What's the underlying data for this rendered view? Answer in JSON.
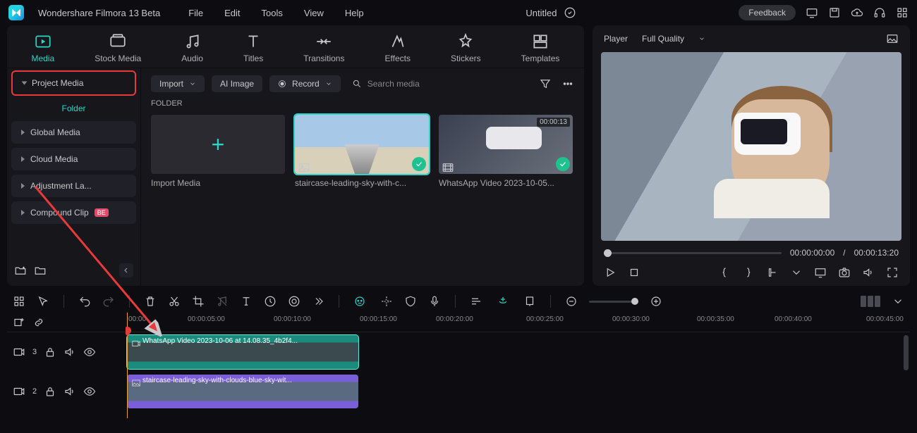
{
  "app": {
    "title": "Wondershare Filmora 13 Beta"
  },
  "menu": [
    "File",
    "Edit",
    "Tools",
    "View",
    "Help"
  ],
  "document": {
    "name": "Untitled"
  },
  "title_actions": {
    "feedback": "Feedback"
  },
  "main_tabs": [
    "Media",
    "Stock Media",
    "Audio",
    "Titles",
    "Transitions",
    "Effects",
    "Stickers",
    "Templates"
  ],
  "sidebar": {
    "project_media": "Project Media",
    "folder_label": "Folder",
    "items": [
      {
        "label": "Global Media"
      },
      {
        "label": "Cloud Media"
      },
      {
        "label": "Adjustment La..."
      },
      {
        "label": "Compound Clip",
        "badge": "BE"
      }
    ]
  },
  "media_toolbar": {
    "import": "Import",
    "ai_image": "AI Image",
    "record": "Record",
    "search_placeholder": "Search media"
  },
  "media_area": {
    "folder_heading": "FOLDER",
    "import_media": "Import Media",
    "thumbs": [
      {
        "label": "staircase-leading-sky-with-c...",
        "selected": true
      },
      {
        "label": "WhatsApp Video 2023-10-05...",
        "duration": "00:00:13"
      }
    ]
  },
  "player": {
    "label": "Player",
    "quality": "Full Quality",
    "time_current": "00:00:00:00",
    "time_sep": "/",
    "time_total": "00:00:13:20"
  },
  "timeline": {
    "ruler": [
      "00:00",
      "00:00:05:00",
      "00:00:10:00",
      "00:00:15:00",
      "00:00:20:00",
      "00:00:25:00",
      "00:00:30:00",
      "00:00:35:00",
      "00:00:40:00",
      "00:00:45:00"
    ],
    "tracks": [
      {
        "num": "3",
        "clip": "WhatsApp Video 2023-10-06 at 14.08.35_4b2f4..."
      },
      {
        "num": "2",
        "clip": "staircase-leading-sky-with-clouds-blue-sky-wit..."
      }
    ]
  }
}
